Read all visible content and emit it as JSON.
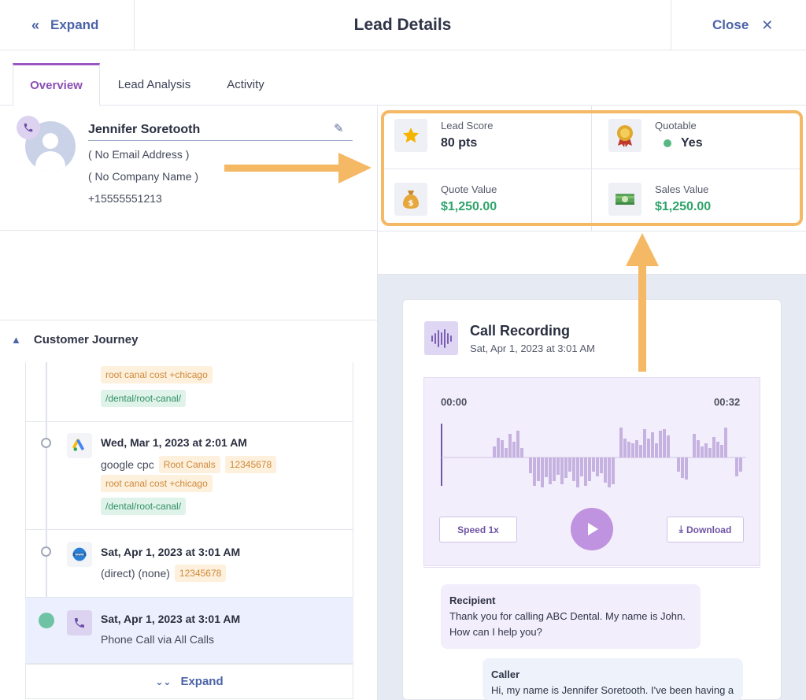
{
  "header": {
    "expand_label": "Expand",
    "title": "Lead Details",
    "close_label": "Close"
  },
  "tabs": [
    {
      "label": "Overview",
      "active": true
    },
    {
      "label": "Lead Analysis",
      "active": false
    },
    {
      "label": "Activity",
      "active": false
    }
  ],
  "contact": {
    "name": "Jennifer Soretooth",
    "email": "( No Email Address )",
    "company": "( No Company Name )",
    "phone": "+15555551213"
  },
  "stats": {
    "lead_score": {
      "label": "Lead Score",
      "value": "80 pts",
      "icon": "star-icon"
    },
    "quotable": {
      "label": "Quotable",
      "value": "Yes",
      "icon": "award-ribbon-icon"
    },
    "quote_value": {
      "label": "Quote Value",
      "value": "$1,250.00",
      "icon": "money-bag-icon"
    },
    "sales_value": {
      "label": "Sales Value",
      "value": "$1,250.00",
      "icon": "cash-stack-icon"
    }
  },
  "journey": {
    "title": "Customer Journey",
    "items": [
      {
        "date": "",
        "source": "",
        "tags_orange": [
          "root canal cost +chicago"
        ],
        "tags_green": [
          "/dental/root-canal/"
        ]
      },
      {
        "date": "Wed, Mar 1, 2023 at 2:01 AM",
        "source": "google cpc",
        "tags_inline": [
          "Root Canals",
          "12345678"
        ],
        "tags_orange": [
          "root canal cost +chicago"
        ],
        "tags_green": [
          "/dental/root-canal/"
        ],
        "icon": "google-ads-icon"
      },
      {
        "date": "Sat, Apr 1, 2023 at 3:01 AM",
        "source": "(direct) (none)",
        "tags_inline": [
          "12345678"
        ],
        "icon": "www-globe-icon"
      },
      {
        "date": "Sat, Apr 1, 2023 at 3:01 AM",
        "source": "Phone Call via All Calls",
        "icon": "phone-icon"
      }
    ],
    "expand_label": "Expand"
  },
  "call": {
    "title": "Call Recording",
    "date": "Sat, Apr 1, 2023 at 3:01 AM",
    "time_current": "00:00",
    "time_total": "00:32",
    "speed_label": "Speed 1x",
    "download_label": "Download"
  },
  "transcript": [
    {
      "speaker": "Recipient",
      "text": "Thank you for calling ABC Dental. My name is John. How can I help you?"
    },
    {
      "speaker": "Caller",
      "text": "Hi, my name is Jennifer Soretooth. I've been having a"
    }
  ],
  "colors": {
    "accent_purple": "#9a57c2",
    "link_blue": "#4b63a8",
    "money_green": "#2ea36b",
    "highlight_orange": "#f5b865"
  }
}
